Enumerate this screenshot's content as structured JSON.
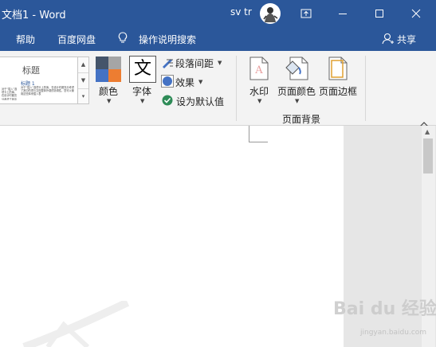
{
  "titlebar": {
    "title": "文档1  -  Word",
    "user": "sv tr",
    "icons": [
      "avatar",
      "ribbon-display-options-icon",
      "minimize-icon",
      "maximize-icon",
      "close-icon"
    ]
  },
  "menubar": {
    "items": [
      "帮助",
      "百度网盘"
    ],
    "tell_me": "操作说明搜索",
    "share": "共享"
  },
  "ribbon": {
    "style_gallery": {
      "heading": "标题",
      "subheading": "标题 1",
      "body_text": "对于“插入”选项卡上的库，在设计时都充分考虑了其中的项与文档整体外观的协调性。您可以使用这些库来插入表"
    },
    "colors_label": "颜色",
    "fonts_label": "字体",
    "fonts_glyph": "文",
    "paragraph_spacing": "段落间距",
    "effects": "效果",
    "set_default": "设为默认值",
    "watermark": "水印",
    "page_color": "页面颜色",
    "page_borders": "页面边框",
    "group_label": "页面背景"
  },
  "watermark_text": "Bai du 经验",
  "watermark_url": "jingyan.baidu.com",
  "colors": {
    "brand": "#2b579a",
    "swatch_dark": "#44546a",
    "swatch_blue": "#4472c4",
    "swatch_orange": "#ed7d31",
    "swatch_gray": "#a5a5a5"
  }
}
